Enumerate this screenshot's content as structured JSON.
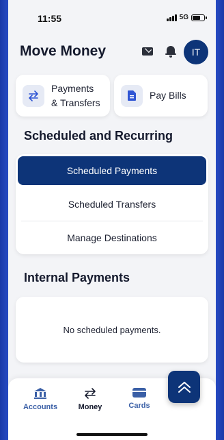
{
  "status": {
    "time": "11:55",
    "network": "5G"
  },
  "header": {
    "title": "Move Money",
    "avatar_initials": "IT"
  },
  "quick_actions": [
    {
      "label_line1": "Payments",
      "label_line2": "& Transfers",
      "icon": "transfer-arrows-icon"
    },
    {
      "label": "Pay Bills",
      "icon": "document-icon"
    }
  ],
  "sections": {
    "scheduled_title": "Scheduled and Recurring",
    "internal_title": "Internal Payments"
  },
  "scheduled_options": [
    {
      "label": "Scheduled Payments",
      "active": true
    },
    {
      "label": "Scheduled Transfers",
      "active": false
    },
    {
      "label": "Manage Destinations",
      "active": false
    }
  ],
  "internal_payments": {
    "empty_message": "No scheduled payments."
  },
  "bottom_nav": [
    {
      "label": "Accounts",
      "icon": "bank-icon",
      "active": false
    },
    {
      "label": "Money",
      "icon": "transfer-arrows-icon",
      "active": true
    },
    {
      "label": "Cards",
      "icon": "credit-card-icon",
      "active": false
    }
  ],
  "colors": {
    "primary": "#0d3478",
    "nav_inactive": "#3a5fa6",
    "background": "#f3f4f7",
    "frame": "#2f55d4"
  }
}
